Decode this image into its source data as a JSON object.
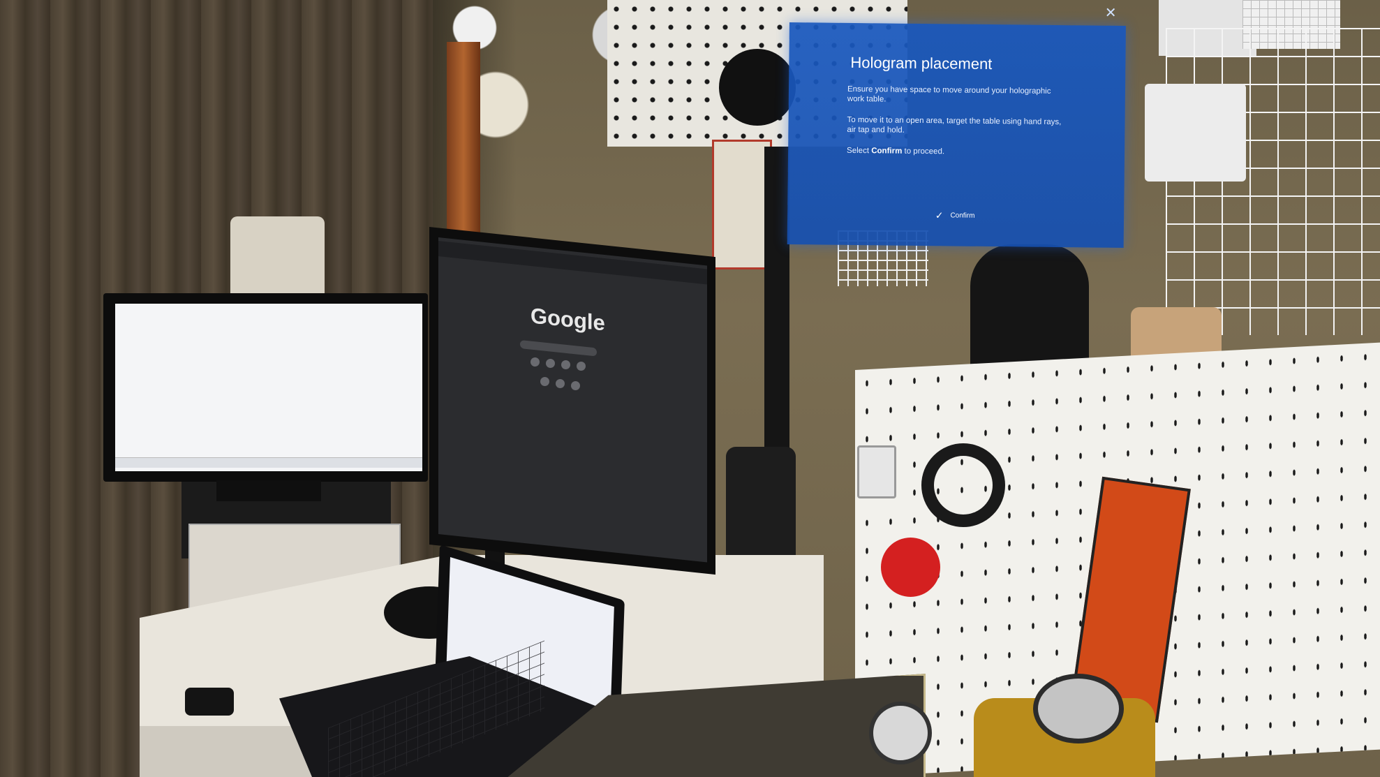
{
  "hologram_dialog": {
    "title": "Hologram placement",
    "paragraph_1": "Ensure you have space to move around your holographic work table.",
    "paragraph_2": "To move it to an open area, target the table using hand rays, air tap and hold.",
    "paragraph_3_prefix": "Select",
    "paragraph_3_emphasis": "Confirm",
    "paragraph_3_suffix": "to proceed.",
    "confirm_label": "Confirm",
    "confirm_icon": "checkmark-icon",
    "close_icon": "close-icon"
  },
  "scene": {
    "center_monitor_logo": "Google"
  },
  "colors": {
    "dialog_blue": "#1958be",
    "dialog_text": "#ffffff"
  }
}
